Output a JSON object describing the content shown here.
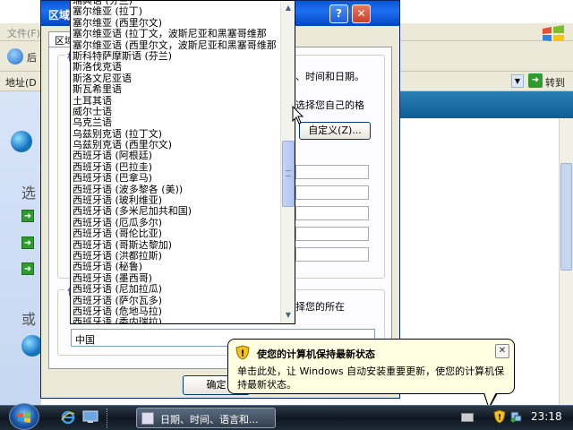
{
  "background_window": {
    "menubar_text": "文件(F)",
    "back_label": "后",
    "address_label": "地址(D",
    "go_label": "转到",
    "side_label_1": "选",
    "side_label_2": "或"
  },
  "dialog": {
    "title": "区域",
    "tab_label": "区域",
    "group1_label": "标",
    "text_time_date": "、时间和日期。",
    "text_choose_format": "选择您自己的格",
    "customize_button": "自定义(Z)...",
    "group2_label": "位",
    "text_location": "择您的所在",
    "country_value": "中国",
    "ok_button": "确定"
  },
  "dropdown": {
    "items": [
      "瑞典语 (芬兰)",
      "塞尔维亚 (拉丁)",
      "塞尔维亚 (西里尔文)",
      "塞尔维亚语 (拉丁文，波斯尼亚和黑塞哥维那",
      "塞尔维亚语 (西里尔文，波斯尼亚和黑塞哥维那",
      "斯科特萨摩斯语 (芬兰)",
      "斯洛伐克语",
      "斯洛文尼亚语",
      "斯瓦希里语",
      "土耳其语",
      "威尔士语",
      "乌克兰语",
      "乌兹别克语 (拉丁文)",
      "乌兹别克语 (西里尔文)",
      "西班牙语 (阿根廷)",
      "西班牙语 (巴拉圭)",
      "西班牙语 (巴拿马)",
      "西班牙语 (波多黎各 (美))",
      "西班牙语 (玻利维亚)",
      "西班牙语 (多米尼加共和国)",
      "西班牙语 (厄瓜多尔)",
      "西班牙语 (哥伦比亚)",
      "西班牙语 (哥斯达黎加)",
      "西班牙语 (洪都拉斯)",
      "西班牙语 (秘鲁)",
      "西班牙语 (墨西哥)",
      "西班牙语 (尼加拉瓜)",
      "西班牙语 (萨尔瓦多)",
      "西班牙语 (危地马拉)",
      "西班牙语 (委内瑞拉)"
    ],
    "scrollbar_position": 0.55
  },
  "balloon": {
    "title": "使您的计算机保持最新状态",
    "body": "单击此处，让 Windows 自动安装重要更新，使您的计算机保持最新状态。",
    "close_glyph": "✕"
  },
  "taskbar": {
    "task_label": "日期、时间、语言和...",
    "clock": "23:18"
  },
  "colors": {
    "titlebar": "#0a58d7",
    "balloon_bg": "#ffffe1",
    "taskbar": "#0f1720"
  }
}
